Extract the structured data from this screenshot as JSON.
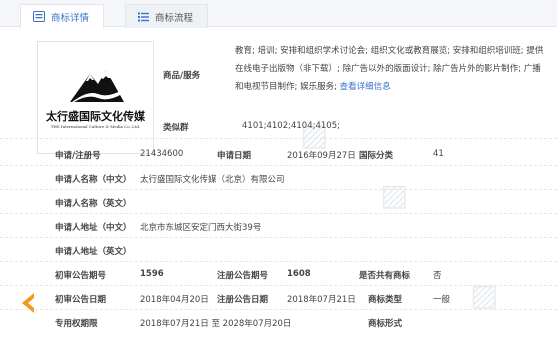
{
  "tabs": [
    {
      "label": "商标详情",
      "icon": "info-card-icon"
    },
    {
      "label": "商标流程",
      "icon": "list-icon"
    }
  ],
  "logo": {
    "cn": "太行盛国际文化传媒",
    "en": "THS International Culture & Media Co.,Ltd."
  },
  "goods_label": "商品/服务",
  "goods_text": "教育; 培训; 安排和组织学术讨论会; 组织文化或教育展览; 安排和组织培训班; 提供在线电子出版物（非下载）; 除广告以外的版面设计; 除广告片外的影片制作; 广播和电视节目制作; 娱乐服务;",
  "goods_more": "查看详细信息",
  "similar_label": "类似群",
  "similar_value": "4101;4102;4104;4105;",
  "reg_no_label": "申请/注册号",
  "reg_no": "21434600",
  "apply_date_label": "申请日期",
  "apply_date": "2016年09月27日",
  "intl_class_label": "国际分类",
  "intl_class": "41",
  "applicant_cn_label": "申请人名称（中文）",
  "applicant_cn": "太行盛国际文化传媒（北京）有限公司",
  "applicant_en_label": "申请人名称（英文）",
  "address_cn_label": "申请人地址（中文）",
  "address_cn": "北京市东城区安定门西大街39号",
  "address_en_label": "申请人地址（英文）",
  "prelim_no_label": "初审公告期号",
  "prelim_no": "1596",
  "reg_pub_no_label": "注册公告期号",
  "reg_pub_no": "1608",
  "shared_label": "是否共有商标",
  "shared": "否",
  "prelim_date_label": "初审公告日期",
  "prelim_date": "2018年04月20日",
  "reg_pub_date_label": "注册公告日期",
  "reg_pub_date": "2018年07月21日",
  "type_label": "商标类型",
  "type": "一般",
  "term_label": "专用权期限",
  "term": "2018年07月21日 至 2028年07月20日",
  "form_label": "商标形式",
  "colors": {
    "accent": "#3a73c8",
    "arrow": "#f39a1e"
  }
}
